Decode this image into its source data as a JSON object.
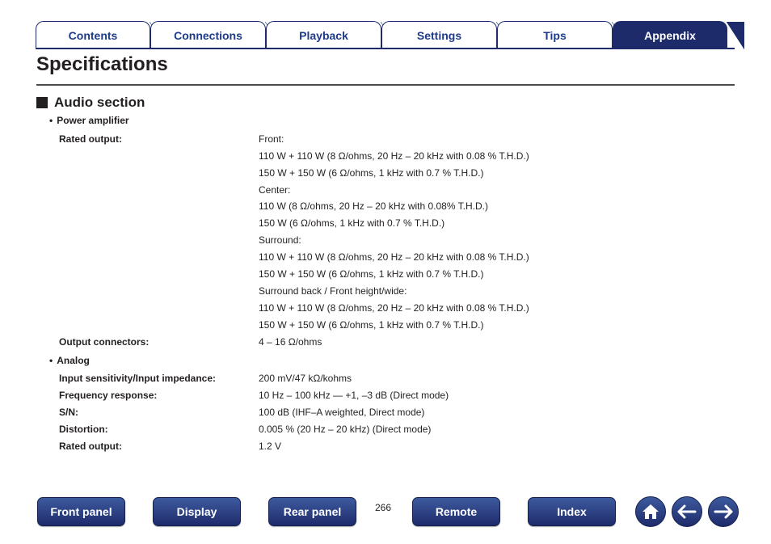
{
  "tabs": [
    {
      "label": "Contents",
      "active": false
    },
    {
      "label": "Connections",
      "active": false
    },
    {
      "label": "Playback",
      "active": false
    },
    {
      "label": "Settings",
      "active": false
    },
    {
      "label": "Tips",
      "active": false
    },
    {
      "label": "Appendix",
      "active": true
    }
  ],
  "page_title": "Specifications",
  "section": {
    "title": "Audio section"
  },
  "power_amplifier": {
    "heading": "Power amplifier",
    "rated_output_label": "Rated output:",
    "rated_output_values": [
      "Front:",
      "110 W + 110 W (8 Ω/ohms, 20 Hz – 20 kHz with 0.08 % T.H.D.)",
      "150 W + 150 W (6 Ω/ohms, 1 kHz with 0.7 % T.H.D.)",
      "Center:",
      "110 W (8 Ω/ohms, 20 Hz – 20 kHz with 0.08% T.H.D.)",
      "150 W (6 Ω/ohms, 1 kHz with 0.7 % T.H.D.)",
      "Surround:",
      "110 W + 110 W (8 Ω/ohms, 20 Hz – 20 kHz with 0.08 % T.H.D.)",
      "150 W + 150 W (6 Ω/ohms, 1 kHz with 0.7 % T.H.D.)",
      "Surround back / Front height/wide:",
      "110 W + 110 W (8 Ω/ohms, 20 Hz – 20 kHz with 0.08 % T.H.D.)",
      "150 W + 150 W (6 Ω/ohms, 1 kHz with 0.7 % T.H.D.)"
    ],
    "output_connectors_label": "Output connectors:",
    "output_connectors_value": "4 – 16 Ω/ohms"
  },
  "analog": {
    "heading": "Analog",
    "rows": [
      {
        "label": "Input sensitivity/Input impedance:",
        "value": "200 mV/47 kΩ/kohms"
      },
      {
        "label": "Frequency response:",
        "value": "10 Hz – 100 kHz — +1, –3 dB (Direct mode)"
      },
      {
        "label": "S/N:",
        "value": "100 dB (IHF–A weighted, Direct mode)"
      },
      {
        "label": "Distortion:",
        "value": "0.005 % (20 Hz – 20 kHz) (Direct mode)"
      },
      {
        "label": "Rated output:",
        "value": "1.2 V"
      }
    ]
  },
  "footer": {
    "buttons": [
      "Front panel",
      "Display",
      "Rear panel",
      "Remote",
      "Index"
    ],
    "page_number": "266",
    "icons": [
      "home-icon",
      "back-arrow-icon",
      "forward-arrow-icon"
    ]
  },
  "colors": {
    "accent": "#1e2b6b",
    "tab_text": "#1e3a8a",
    "text": "#231f20"
  }
}
